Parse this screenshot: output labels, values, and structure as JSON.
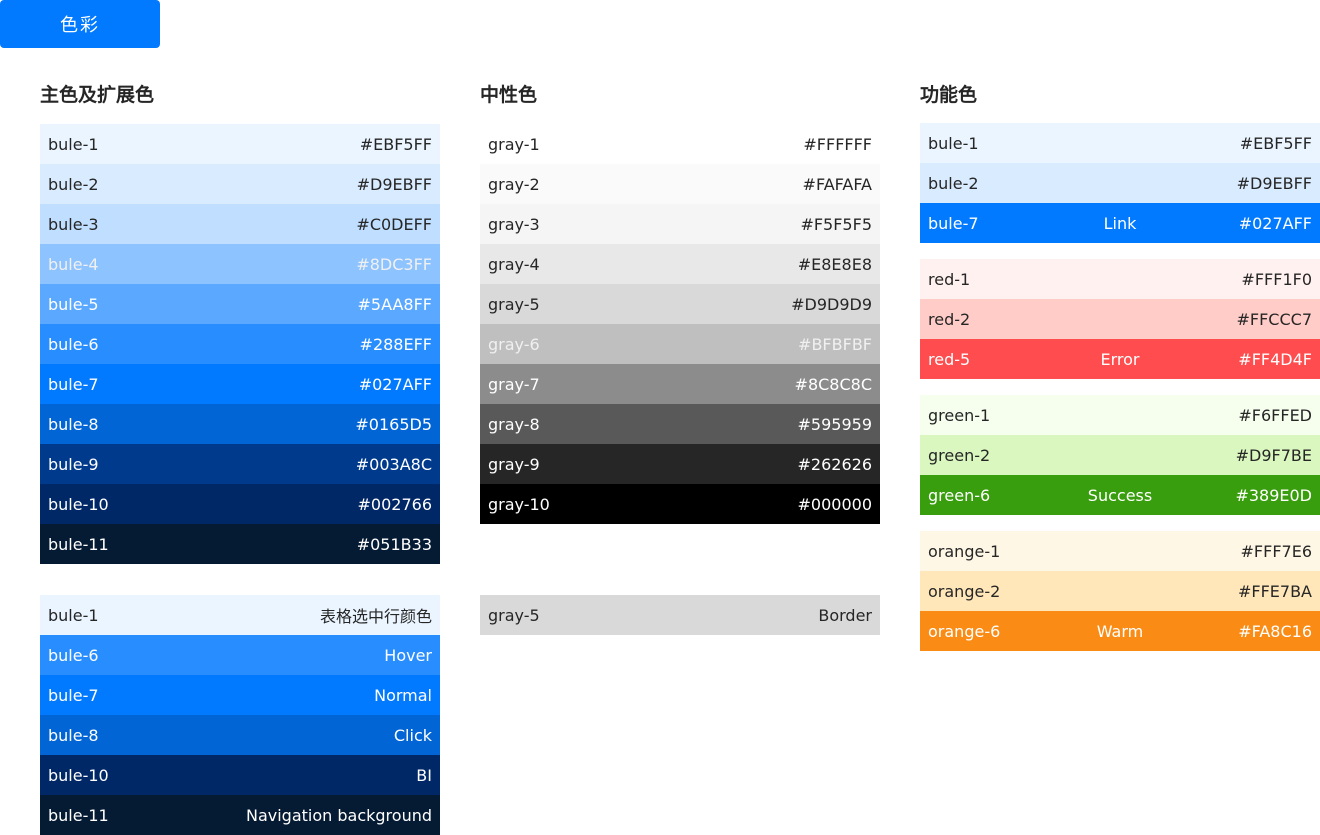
{
  "header": {
    "tag_label": "色彩"
  },
  "sections": {
    "primary_title": "主色及扩展色",
    "neutral_title": "中性色",
    "functional_title": "功能色"
  },
  "primary": [
    {
      "name": "bule-1",
      "value": "#EBF5FF",
      "color": "#EBF5FF"
    },
    {
      "name": "bule-2",
      "value": "#D9EBFF",
      "color": "#D9EBFF"
    },
    {
      "name": "bule-3",
      "value": "#C0DEFF",
      "color": "#C0DEFF"
    },
    {
      "name": "bule-4",
      "value": "#8DC3FF",
      "color": "#8DC3FF"
    },
    {
      "name": "bule-5",
      "value": "#5AA8FF",
      "color": "#5AA8FF"
    },
    {
      "name": "bule-6",
      "value": "#288EFF",
      "color": "#288EFF"
    },
    {
      "name": "bule-7",
      "value": "#027AFF",
      "color": "#027AFF"
    },
    {
      "name": "bule-8",
      "value": "#0165D5",
      "color": "#0165D5"
    },
    {
      "name": "bule-9",
      "value": "#003A8C",
      "color": "#003A8C"
    },
    {
      "name": "bule-10",
      "value": "#002766",
      "color": "#002766"
    },
    {
      "name": "bule-11",
      "value": "#051B33",
      "color": "#051B33"
    }
  ],
  "primary_usage": [
    {
      "name": "bule-1",
      "value": "表格选中行颜色",
      "color": "#EBF5FF"
    },
    {
      "name": "bule-6",
      "value": "Hover",
      "color": "#288EFF"
    },
    {
      "name": "bule-7",
      "value": "Normal",
      "color": "#027AFF"
    },
    {
      "name": "bule-8",
      "value": "Click",
      "color": "#0165D5"
    },
    {
      "name": "bule-10",
      "value": "BI",
      "color": "#002766"
    },
    {
      "name": "bule-11",
      "value": "Navigation background",
      "color": "#051B33"
    }
  ],
  "neutral": [
    {
      "name": "gray-1",
      "value": "#FFFFFF",
      "color": "#FFFFFF"
    },
    {
      "name": "gray-2",
      "value": "#FAFAFA",
      "color": "#FAFAFA"
    },
    {
      "name": "gray-3",
      "value": "#F5F5F5",
      "color": "#F5F5F5"
    },
    {
      "name": "gray-4",
      "value": "#E8E8E8",
      "color": "#E8E8E8"
    },
    {
      "name": "gray-5",
      "value": "#D9D9D9",
      "color": "#D9D9D9"
    },
    {
      "name": "gray-6",
      "value": "#BFBFBF",
      "color": "#BFBFBF"
    },
    {
      "name": "gray-7",
      "value": "#8C8C8C",
      "color": "#8C8C8C"
    },
    {
      "name": "gray-8",
      "value": "#595959",
      "color": "#595959"
    },
    {
      "name": "gray-9",
      "value": "#262626",
      "color": "#262626"
    },
    {
      "name": "gray-10",
      "value": "#000000",
      "color": "#000000"
    }
  ],
  "neutral_usage": [
    {
      "name": "gray-5",
      "value": "Border",
      "color": "#D9D9D9"
    }
  ],
  "functional": [
    [
      {
        "name": "bule-1",
        "mid": "",
        "value": "#EBF5FF",
        "color": "#EBF5FF"
      },
      {
        "name": "bule-2",
        "mid": "",
        "value": "#D9EBFF",
        "color": "#D9EBFF"
      },
      {
        "name": "bule-7",
        "mid": "Link",
        "value": "#027AFF",
        "color": "#027AFF"
      }
    ],
    [
      {
        "name": "red-1",
        "mid": "",
        "value": "#FFF1F0",
        "color": "#FFF1F0"
      },
      {
        "name": "red-2",
        "mid": "",
        "value": "#FFCCC7",
        "color": "#FFCCC7"
      },
      {
        "name": "red-5",
        "mid": "Error",
        "value": "#FF4D4F",
        "color": "#FF4D4F"
      }
    ],
    [
      {
        "name": "green-1",
        "mid": "",
        "value": "#F6FFED",
        "color": "#F6FFED"
      },
      {
        "name": "green-2",
        "mid": "",
        "value": "#D9F7BE",
        "color": "#D9F7BE"
      },
      {
        "name": "green-6",
        "mid": "Success",
        "value": "#389E0D",
        "color": "#389E0D"
      }
    ],
    [
      {
        "name": "orange-1",
        "mid": "",
        "value": "#FFF7E6",
        "color": "#FFF7E6"
      },
      {
        "name": "orange-2",
        "mid": "",
        "value": "#FFE7BA",
        "color": "#FFE7BA"
      },
      {
        "name": "orange-6",
        "mid": "Warm",
        "value": "#FA8C16",
        "color": "#FA8C16"
      }
    ]
  ]
}
